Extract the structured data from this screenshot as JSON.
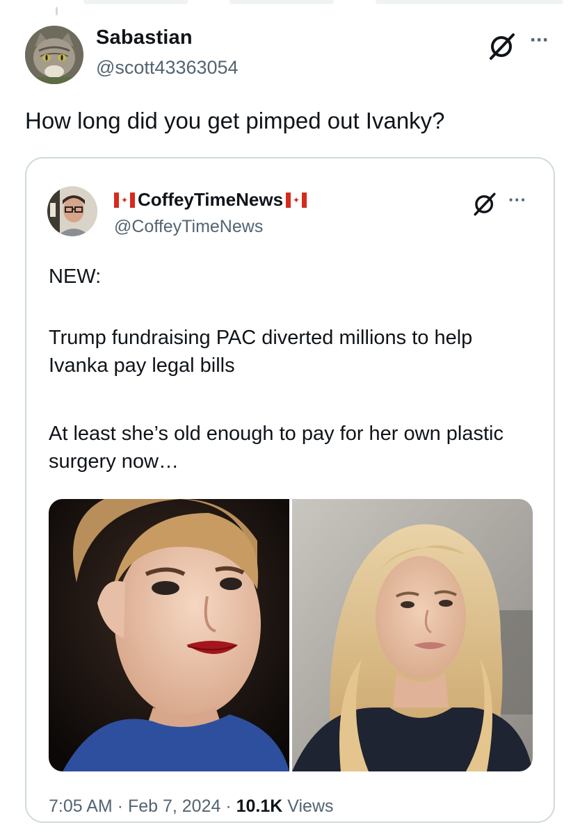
{
  "tweet": {
    "author": {
      "display_name": "Sabastian",
      "handle": "@scott43363054",
      "avatar": "cat-avatar"
    },
    "text": "How long did you get pimped out Ivanky?",
    "icons": {
      "grok": "grok-icon",
      "more": "more-icon"
    }
  },
  "quote": {
    "author": {
      "display_name": "CoffeyTimeNews",
      "handle": "@CoffeyTimeNews",
      "avatar": "man-with-glasses-avatar"
    },
    "flag": "canada-flag",
    "body": {
      "p1": "NEW:",
      "p2": "Trump fundraising PAC diverted millions to help Ivanka pay legal bills",
      "p3": "At least she’s old enough to pay for her own plastic surgery now…"
    },
    "media": [
      "young-woman-red-lips-photo",
      "blonde-woman-photo"
    ],
    "meta": {
      "time": "7:05 AM",
      "sep1": " · ",
      "date": "Feb 7, 2024",
      "sep2": " · ",
      "views_count": "10.1K",
      "views_label": " Views"
    }
  },
  "colors": {
    "text": "#0f1419",
    "secondary": "#536471",
    "border": "#cfd9de",
    "flag_red": "#d52b1e"
  }
}
